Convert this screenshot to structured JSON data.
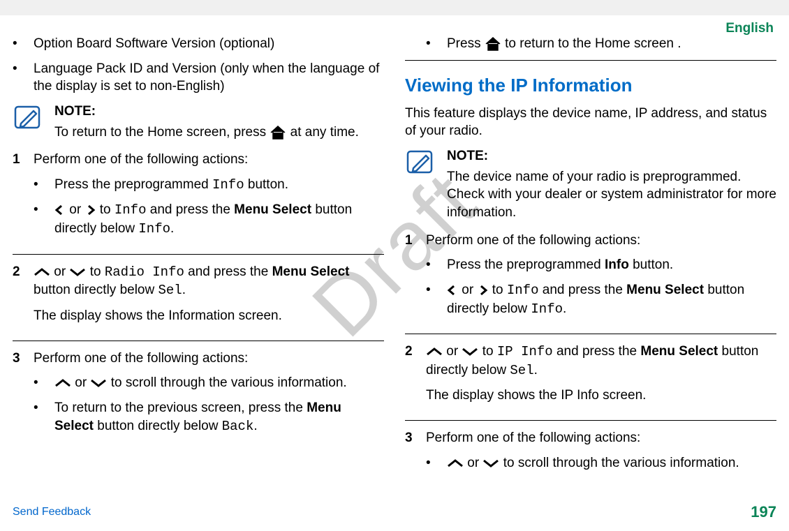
{
  "header": {
    "language": "English"
  },
  "watermark": "Draft",
  "left": {
    "bullets": [
      "Option Board Software Version (optional)",
      "Language Pack ID and Version (only when the language of the display is set to non-English)"
    ],
    "note_label": "NOTE:",
    "note_pre": "To return to the Home screen, press ",
    "note_post": " at any time.",
    "step1": {
      "intro": "Perform one of the following actions:",
      "b1_pre": "Press the preprogrammed ",
      "b1_mono": "Info",
      "b1_post": " button.",
      "b2_to": " to ",
      "b2_mono1": "Info",
      "b2_mid": " and press the ",
      "b2_bold": "Menu Select",
      "b2_mid2": " button directly below ",
      "b2_mono2": "Info",
      "b2_end": "."
    },
    "step2": {
      "to": " to ",
      "mono1": "Radio Info",
      "mid": " and press the ",
      "bold": "Menu Select",
      "mid2": " button directly below ",
      "mono2": "Sel",
      "end": ".",
      "result": "The display shows the Information screen."
    },
    "step3": {
      "intro": "Perform one of the following actions:",
      "b1_post": " to scroll through the various information.",
      "b2_pre": "To return to the previous screen, press the ",
      "b2_bold": "Menu Select",
      "b2_mid": " button directly below ",
      "b2_mono": "Back",
      "b2_end": "."
    }
  },
  "right": {
    "ret_pre": "Press ",
    "ret_post": " to return to the Home screen .",
    "heading": "Viewing the IP Information",
    "intro": "This feature displays the device name, IP address, and status of your radio.",
    "note_label": "NOTE:",
    "note_body": "The device name of your radio is preprogrammed. Check with your dealer or system administrator for more information.",
    "step1": {
      "intro": "Perform one of the following actions:",
      "b1_pre": "Press the preprogrammed ",
      "b1_bold": "Info",
      "b1_post": " button.",
      "b2_to": " to ",
      "b2_mono1": "Info",
      "b2_mid": " and press the ",
      "b2_bold": "Menu Select",
      "b2_mid2": " button directly below ",
      "b2_mono2": "Info",
      "b2_end": "."
    },
    "step2": {
      "to": " to ",
      "mono1": "IP Info",
      "mid": " and press the ",
      "bold": "Menu Select",
      "mid2": " button directly below ",
      "mono2": "Sel",
      "end": ".",
      "result": "The display shows the IP Info screen."
    },
    "step3": {
      "intro": "Perform one of the following actions:",
      "b1_post": " to scroll through the various information."
    }
  },
  "nums": {
    "n1": "1",
    "n2": "2",
    "n3": "3"
  },
  "or": " or ",
  "bullet": "•",
  "footer": {
    "feedback": "Send Feedback",
    "page": "197"
  }
}
